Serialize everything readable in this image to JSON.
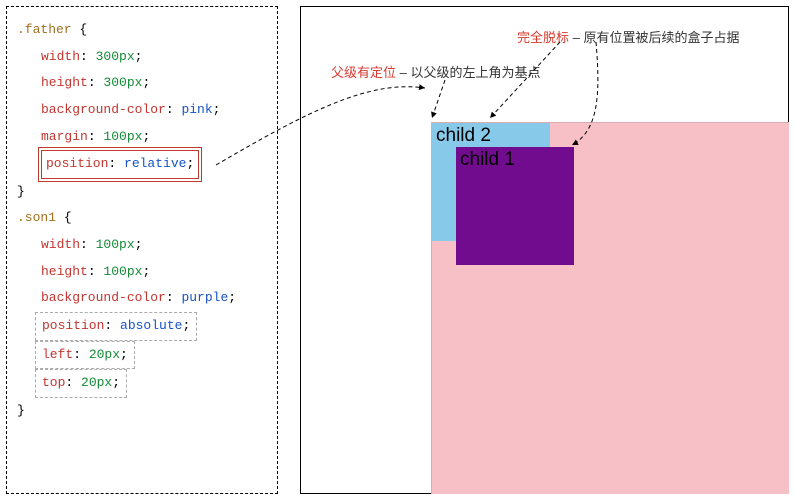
{
  "code": {
    "rule1_selector": ".father",
    "rule1_props": {
      "width": {
        "prop": "width",
        "val": "300px",
        "kind": "num"
      },
      "height": {
        "prop": "height",
        "val": "300px",
        "kind": "num"
      },
      "bgc": {
        "prop": "background-color",
        "val": "pink",
        "kind": "val"
      },
      "margin": {
        "prop": "margin",
        "val": "100px",
        "kind": "num"
      },
      "position": {
        "prop": "position",
        "val": "relative",
        "kind": "val"
      }
    },
    "rule2_selector": ".son1",
    "rule2_props": {
      "width": {
        "prop": "width",
        "val": "100px",
        "kind": "num"
      },
      "height": {
        "prop": "height",
        "val": "100px",
        "kind": "num"
      },
      "bgc": {
        "prop": "background-color",
        "val": "purple",
        "kind": "val"
      },
      "position": {
        "prop": "position",
        "val": "absolute",
        "kind": "val"
      },
      "left": {
        "prop": "left",
        "val": "20px",
        "kind": "num"
      },
      "top": {
        "prop": "top",
        "val": "20px",
        "kind": "num"
      }
    },
    "brace_open": " {",
    "brace_close": "}",
    "colon": ": ",
    "semicolon": ";"
  },
  "render": {
    "child1_label": "child 1",
    "child2_label": "child 2"
  },
  "annotations": {
    "a1_red": "父级有定位",
    "a1_rest": " – 以父级的左上角为基点",
    "a2_red": "完全脱标",
    "a2_rest": " – 原有位置被后续的盒子占据"
  }
}
